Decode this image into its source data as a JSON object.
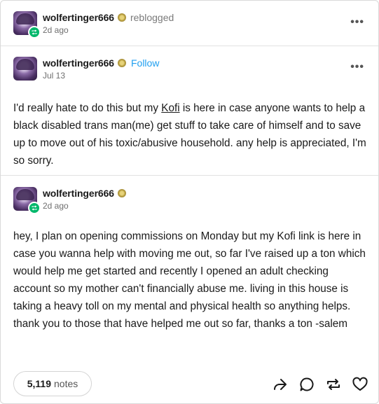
{
  "reblog_header": {
    "username": "wolfertinger666",
    "action": "reblogged",
    "time": "2d ago",
    "menu": "•••"
  },
  "post1": {
    "username": "wolfertinger666",
    "follow_label": "Follow",
    "date": "Jul 13",
    "menu": "•••",
    "text_before_link": "I'd really hate to do this but my ",
    "link_text": "Kofi",
    "text_after_link": " is here in case anyone wants to help a black disabled trans man(me) get stuff to take care of himself and to save up to move out of his toxic/abusive household. any help is appreciated, I'm so sorry."
  },
  "post2": {
    "username": "wolfertinger666",
    "time": "2d ago",
    "text": "hey, I plan on opening commissions on Monday but my Kofi link is here in case you wanna help with moving me out, so far I've raised up a ton which would help me get started and recently I opened an adult checking account so my mother can't financially abuse me. living in this house is taking a heavy toll on my mental and physical health so anything helps. thank you to those that have helped me out so far, thanks a ton -salem"
  },
  "footer": {
    "notes_count": "5,119",
    "notes_label": "notes",
    "icons": [
      "share-icon",
      "reply-icon",
      "reblog-icon",
      "like-icon"
    ]
  }
}
